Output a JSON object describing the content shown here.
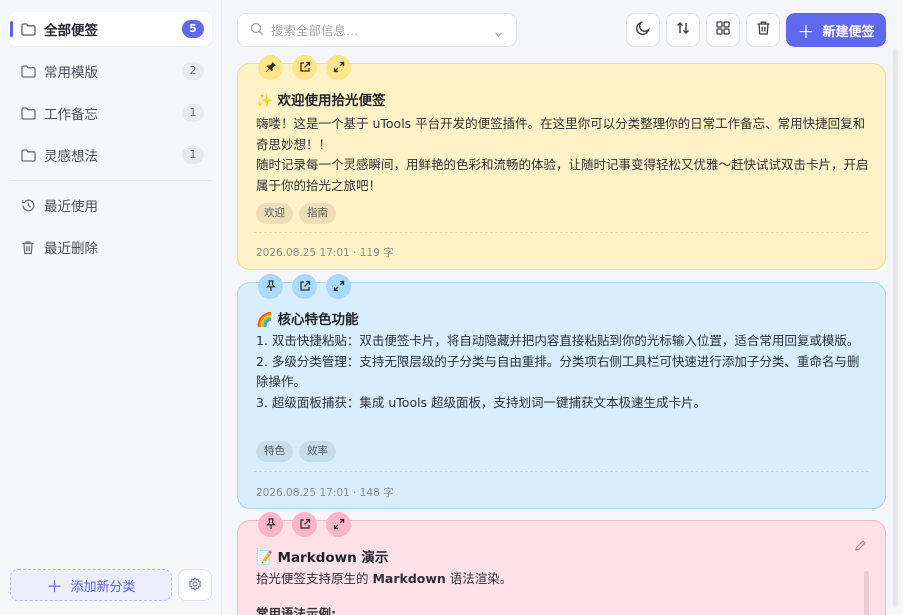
{
  "sidebar": {
    "categories": [
      {
        "label": "全部便签",
        "count": "5"
      },
      {
        "label": "常用模版",
        "count": "2"
      },
      {
        "label": "工作备忘",
        "count": "1"
      },
      {
        "label": "灵感想法",
        "count": "1"
      }
    ],
    "recent_label": "最近使用",
    "deleted_label": "最近删除",
    "add_category_label": "添加新分类"
  },
  "toolbar": {
    "search_placeholder": "搜索全部信息...",
    "new_note_label": "新建便签"
  },
  "notes": [
    {
      "title": "✨ 欢迎使用拾光便签",
      "body_lines": [
        "嗨喽！这是一个基于 uTools 平台开发的便签插件。在这里你可以分类整理你的日常工作备忘、常用快捷回复和奇思妙想！！",
        "随时记录每一个灵感瞬间，用鲜艳的色彩和流畅的体验，让随时记事变得轻松又优雅～赶快试试双击卡片，开启属于你的拾光之旅吧！"
      ],
      "tags": [
        "欢迎",
        "指南"
      ],
      "meta": "2026.08.25 17:01 · 119 字",
      "color": "#fff2c7"
    },
    {
      "title": "🌈 核心特色功能",
      "body_lines": [
        "1. 双击快捷粘贴：双击便签卡片，将自动隐藏并把内容直接粘贴到你的光标输入位置，适合常用回复或模版。",
        "2. 多级分类管理：支持无限层级的子分类与自由重排。分类项右侧工具栏可快速进行添加子分类、重命名与删除操作。",
        "3. 超级面板捕获：集成 uTools 超级面板，支持划词一键捕获文本极速生成卡片。"
      ],
      "tags": [
        "特色",
        "效率"
      ],
      "meta": "2026.08.25 17:01 · 148 字",
      "color": "#d8eefc"
    },
    {
      "title": "📝 Markdown 演示",
      "body_prefix": "拾光便签支持原生的 ",
      "body_bold": "Markdown",
      "body_suffix": " 语法渲染。",
      "subheading": "常用语法示例:",
      "color": "#fde0e8"
    }
  ],
  "colors": {
    "accent": "#6068ee"
  }
}
